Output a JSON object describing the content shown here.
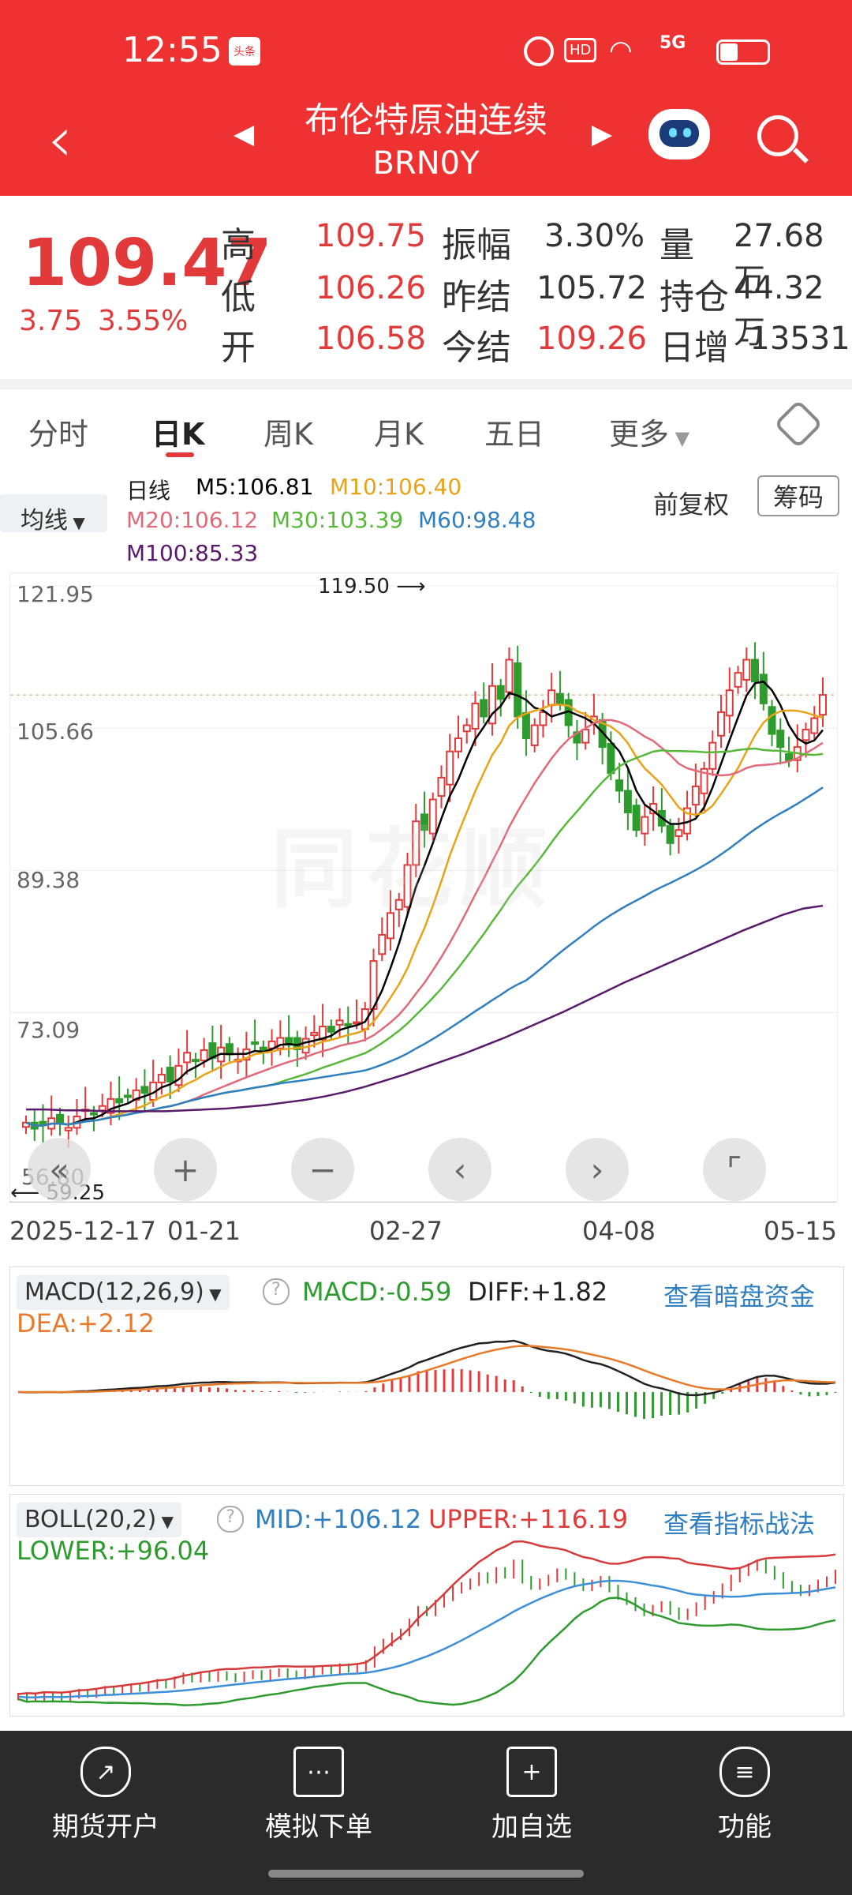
{
  "status": {
    "time": "12:55",
    "app_badge": "头条",
    "hd": "HD",
    "signal": "5G"
  },
  "nav": {
    "title": "布伦特原油连续",
    "subtitle": "BRN0Y"
  },
  "quote": {
    "price": "109.47",
    "change": "3.75",
    "change_pct": "3.55%",
    "high_label": "高",
    "high": "109.75",
    "low_label": "低",
    "low": "106.26",
    "open_label": "开",
    "open": "106.58",
    "amp_label": "振幅",
    "amp": "3.30%",
    "prev_settle_label": "昨结",
    "prev_settle": "105.72",
    "settle_label": "今结",
    "settle": "109.26",
    "vol_label": "量",
    "vol": "27.68万",
    "oi_label": "持仓",
    "oi": "44.32万",
    "daily_inc_label": "日增",
    "daily_inc": "-13531"
  },
  "tabs": [
    "分时",
    "日K",
    "周K",
    "月K",
    "五日",
    "更多"
  ],
  "ma": {
    "selector": "均线",
    "line_label": "日线",
    "m5": "M5:106.81",
    "m10": "M10:106.40",
    "m20": "M20:106.12",
    "m30": "M30:103.39",
    "m60": "M60:98.48",
    "m100": "M100:85.33",
    "adjust": "前复权",
    "chips": "筹码",
    "colors": {
      "m5": "#000000",
      "m10": "#e8a317",
      "m20": "#e06a7a",
      "m30": "#58b83a",
      "m60": "#2f7fc1",
      "m100": "#5a1a6b"
    }
  },
  "chart_data": {
    "type": "candlestick",
    "y_ticks": [
      "121.95",
      "105.66",
      "89.38",
      "73.09",
      "56.80"
    ],
    "high_marker": "119.50",
    "low_marker": "59.25",
    "x_ticks": [
      "2025-12-17",
      "01-21",
      "02-27",
      "04-08",
      "05-15"
    ],
    "closes": [
      60.5,
      59.8,
      60.2,
      61.0,
      60.4,
      59.9,
      61.2,
      62.0,
      61.5,
      62.4,
      63.2,
      62.8,
      63.5,
      64.2,
      63.9,
      65.1,
      66.0,
      65.2,
      67.0,
      68.5,
      67.6,
      68.8,
      67.9,
      69.1,
      68.3,
      67.7,
      68.9,
      69.5,
      68.6,
      69.8,
      70.2,
      69.4,
      68.9,
      70.1,
      70.8,
      71.5,
      70.9,
      72.2,
      71.6,
      72.0,
      73.5,
      79.0,
      82.0,
      84.5,
      86.0,
      90.0,
      95.0,
      94.0,
      97.5,
      100.0,
      103.0,
      104.5,
      106.0,
      108.5,
      107.0,
      110.5,
      109.0,
      113.5,
      107.0,
      104.5,
      106.0,
      107.5,
      110.0,
      108.5,
      106.0,
      104.0,
      105.5,
      107.0,
      103.5,
      100.5,
      98.5,
      96.0,
      94.0,
      95.5,
      97.0,
      94.5,
      92.5,
      94.0,
      96.5,
      99.0,
      101.0,
      104.0,
      107.5,
      110.0,
      112.0,
      113.5,
      111.0,
      108.5,
      105.0,
      103.5,
      102.0,
      103.5,
      105.5,
      106.8,
      109.47
    ],
    "m100": [
      62,
      62.0,
      61.9,
      61.9,
      61.8,
      61.8,
      61.8,
      61.8,
      61.9,
      62.0,
      62.1,
      62.3,
      62.5,
      62.8,
      63.1,
      63.5,
      64.0,
      64.6,
      65.3,
      66.0,
      66.8,
      67.6,
      68.4,
      69.3,
      70.2,
      71.2,
      72.2,
      73.2,
      74.3,
      75.4,
      76.5,
      77.5,
      78.5,
      79.5,
      80.5,
      81.5,
      82.5,
      83.4,
      84.3,
      85.0,
      85.33
    ]
  },
  "macd": {
    "title": "MACD(12,26,9)",
    "macd": "MACD:-0.59",
    "diff": "DIFF:+1.82",
    "dea": "DEA:+2.12",
    "link": "查看暗盘资金"
  },
  "boll": {
    "title": "BOLL(20,2)",
    "mid": "MID:+106.12",
    "upper": "UPPER:+116.19",
    "lower": "LOWER:+96.04",
    "link": "查看指标战法"
  },
  "bottom": [
    "期货开户",
    "模拟下单",
    "加自选",
    "功能"
  ],
  "watermark": "同花顺"
}
